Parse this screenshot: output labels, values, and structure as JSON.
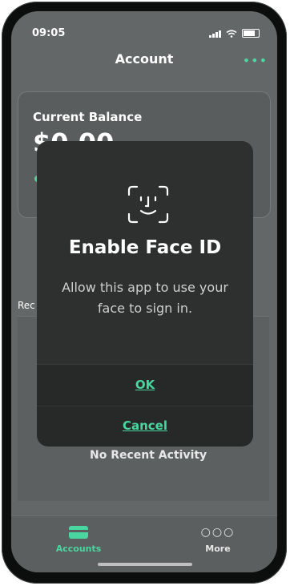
{
  "status_bar": {
    "time": "09:05"
  },
  "header": {
    "title": "Account",
    "menu_icon": "more-dots-icon"
  },
  "balance_card": {
    "title": "Current Balance",
    "amount": "$0.00",
    "label_initial": "N"
  },
  "recent_label": "Rec",
  "activity": {
    "empty_text": "No Recent Activity"
  },
  "bottom_nav": {
    "items": [
      {
        "label": "Accounts",
        "icon": "card-icon",
        "active": true
      },
      {
        "label": "More",
        "icon": "dots-icon",
        "active": false
      }
    ]
  },
  "modal": {
    "title": "Enable Face ID",
    "message": "Allow this app to use your face to sign in.",
    "ok_label": "OK",
    "cancel_label": "Cancel",
    "icon": "face-id-icon"
  },
  "colors": {
    "accent": "#4ad6a0",
    "modal_bg": "#2d302f",
    "overlay_bg": "#646767"
  }
}
